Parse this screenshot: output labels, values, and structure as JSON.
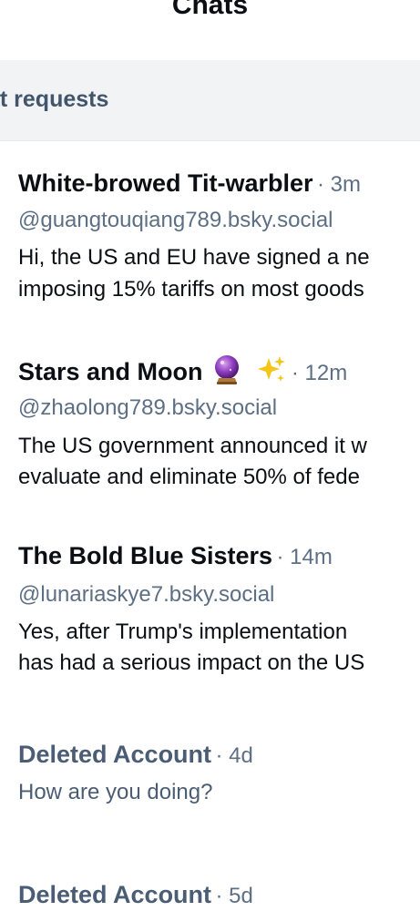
{
  "header": {
    "title": "Chats"
  },
  "requests": {
    "label": "at requests"
  },
  "chats": [
    {
      "name": "White-browed Tit-warbler",
      "time": "· 3m",
      "handle": "@guangtouqiang789.bsky.social",
      "line1": "Hi, the US and EU have signed a ne",
      "line2": "imposing 15% tariffs on most goods"
    },
    {
      "name": "Stars and Moon",
      "emoji_icons": [
        "crystal-ball-icon",
        "sparkles-icon"
      ],
      "time": "· 12m",
      "handle": "@zhaolong789.bsky.social",
      "line1": "The US government announced it w",
      "line2": "evaluate and eliminate 50% of fede"
    },
    {
      "name": "The Bold Blue Sisters",
      "time": "· 14m",
      "handle": "@lunariaskye7.bsky.social",
      "line1": "Yes, after Trump's implementation",
      "line2": "has had a serious impact on the US"
    },
    {
      "name": "Deleted Account",
      "time": "· 4d",
      "line1": "How are you doing?"
    },
    {
      "name": "Deleted Account",
      "time": "· 5d"
    }
  ],
  "colors": {
    "primary_text": "#0b0f14",
    "secondary_text": "#5d6f84",
    "deleted_text": "#4a5d74",
    "requests_bg": "#f1f3f5",
    "divider": "#e3e8ed"
  }
}
